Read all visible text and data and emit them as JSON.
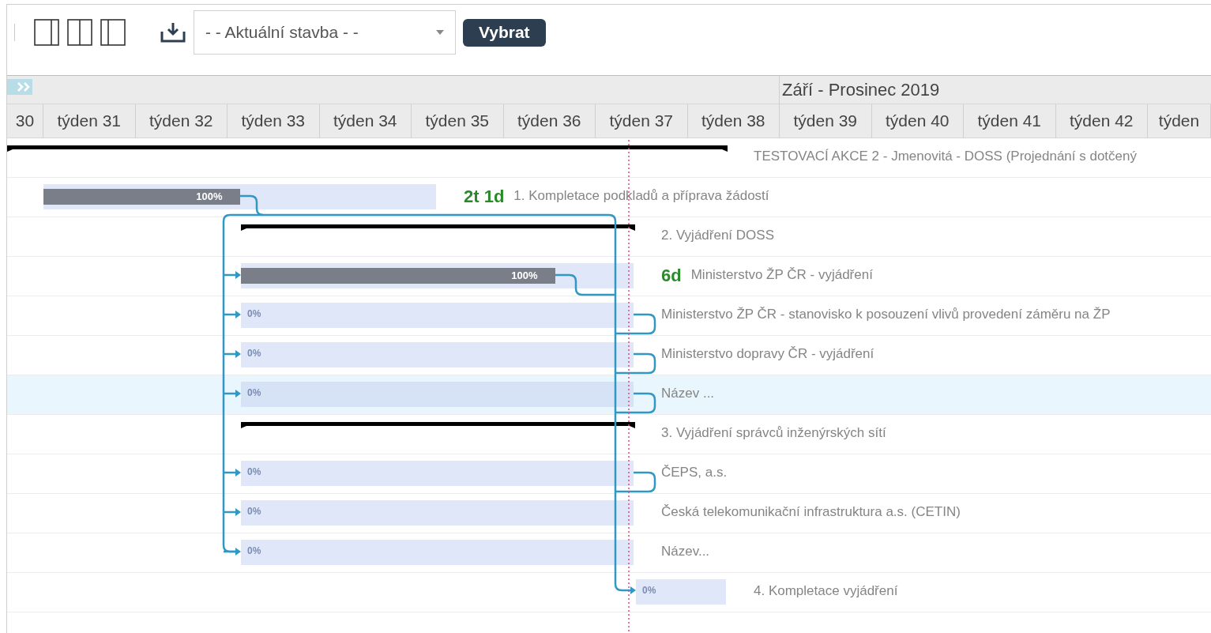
{
  "toolbar": {
    "select": {
      "value": "- - Aktuální stavba - -"
    },
    "button": "Vybrat"
  },
  "timeline": {
    "period": "Září - Prosinec 2019",
    "weeks": [
      "30",
      "týden 31",
      "týden 32",
      "týden 33",
      "týden 34",
      "týden 35",
      "týden 36",
      "týden 37",
      "týden 38",
      "týden 39",
      "týden 40",
      "týden 41",
      "týden 42",
      "týden"
    ]
  },
  "rows": [
    {
      "kind": "summary",
      "label": "TESTOVACÍ AKCE 2 - Jmenovitá - DOSS (Projednání s dotčený",
      "selected": false
    },
    {
      "kind": "task",
      "progress": "100%",
      "level": 0.5,
      "duration": "2t 1d",
      "label": "1. Kompletace podkladů a příprava žádostí",
      "selected": false
    },
    {
      "kind": "summary",
      "label": "2. Vyjádření DOSS",
      "selected": false
    },
    {
      "kind": "task",
      "progress": "100%",
      "level": 0.8,
      "duration": "6d",
      "label": "Ministerstvo ŽP ČR - vyjádření",
      "selected": false
    },
    {
      "kind": "task",
      "progress": "0%",
      "label": "Ministerstvo ŽP ČR - stanovisko k posouzení vlivů provedení záměru na ŽP",
      "selected": false
    },
    {
      "kind": "task",
      "progress": "0%",
      "label": "Ministerstvo dopravy ČR - vyjádření",
      "selected": false
    },
    {
      "kind": "task",
      "progress": "0%",
      "label": "Název ...",
      "selected": true
    },
    {
      "kind": "summary",
      "label": "3. Vyjádření správců inženýrských sítí",
      "selected": false
    },
    {
      "kind": "task",
      "progress": "0%",
      "label": "ČEPS, a.s.",
      "selected": false
    },
    {
      "kind": "task",
      "progress": "0%",
      "label": "Česká telekomunikační infrastruktura a.s. (CETIN)",
      "selected": false
    },
    {
      "kind": "task",
      "progress": "0%",
      "label": "Název...",
      "selected": false
    },
    {
      "kind": "task",
      "progress": "0%",
      "label": "4. Kompletace vyjádření",
      "selected": false
    }
  ]
}
